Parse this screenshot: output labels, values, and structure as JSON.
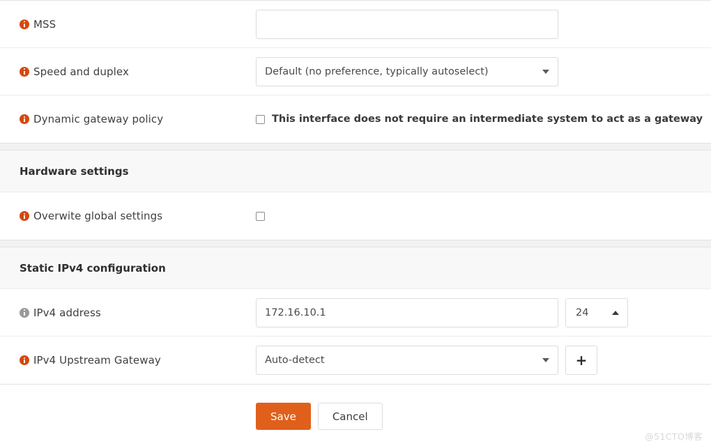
{
  "panels": [
    {
      "rows": [
        {
          "label": "MSS",
          "icon": "info-icon",
          "icon_color": "#d4490d",
          "control": "text",
          "value": "",
          "placeholder": ""
        },
        {
          "label": "Speed and duplex",
          "icon": "info-icon",
          "icon_color": "#d4490d",
          "control": "select",
          "value": "Default (no preference, typically autoselect)"
        },
        {
          "label": "Dynamic gateway policy",
          "icon": "info-icon",
          "icon_color": "#d4490d",
          "control": "checkbox",
          "checkbox_label": "This interface does not require an intermediate system to act as a gateway",
          "checked": false
        }
      ]
    },
    {
      "section_title": "Hardware settings",
      "rows": [
        {
          "label": "Overwite global settings",
          "icon": "info-icon",
          "icon_color": "#d4490d",
          "control": "checkbox",
          "checkbox_label": "",
          "checked": false
        }
      ]
    },
    {
      "section_title": "Static IPv4 configuration",
      "rows": [
        {
          "label": "IPv4 address",
          "icon": "info-icon",
          "icon_color": "#9a9a9a",
          "control": "text-with-stepper",
          "value": "172.16.10.1",
          "prefix": "24"
        },
        {
          "label": "IPv4 Upstream Gateway",
          "icon": "info-icon",
          "icon_color": "#d4490d",
          "control": "select-with-add",
          "value": "Auto-detect",
          "add_label": "+"
        }
      ]
    }
  ],
  "labels": {
    "mss": "MSS",
    "speed_and_duplex": "Speed and duplex",
    "dynamic_gateway_policy": "Dynamic gateway policy",
    "overwite_global_settings": "Overwite global settings",
    "ipv4_address": "IPv4 address",
    "ipv4_upstream_gateway": "IPv4 Upstream Gateway"
  },
  "sections": {
    "hardware_settings": "Hardware settings",
    "static_ipv4_configuration": "Static IPv4 configuration"
  },
  "values": {
    "mss": "",
    "mss_placeholder": "",
    "speed_and_duplex": "Default (no preference, typically autoselect)",
    "dynamic_gateway_checkbox_label": "This interface does not require an intermediate system to act as a gateway",
    "ipv4_address": "172.16.10.1",
    "ipv4_prefix": "24",
    "ipv4_upstream_gateway": "Auto-detect",
    "add_gateway_label": "+"
  },
  "footer": {
    "save_label": "Save",
    "cancel_label": "Cancel"
  },
  "watermark": "@51CTO博客",
  "colors": {
    "accent": "#d4490d",
    "save_button": "#e0601b",
    "info_icon_orange": "#d4490d",
    "info_icon_gray": "#9a9a9a",
    "panel_background": "#ffffff",
    "page_background": "#f2f2f2",
    "section_header_background": "#f8f8f8",
    "border": "#e2e2e2"
  }
}
